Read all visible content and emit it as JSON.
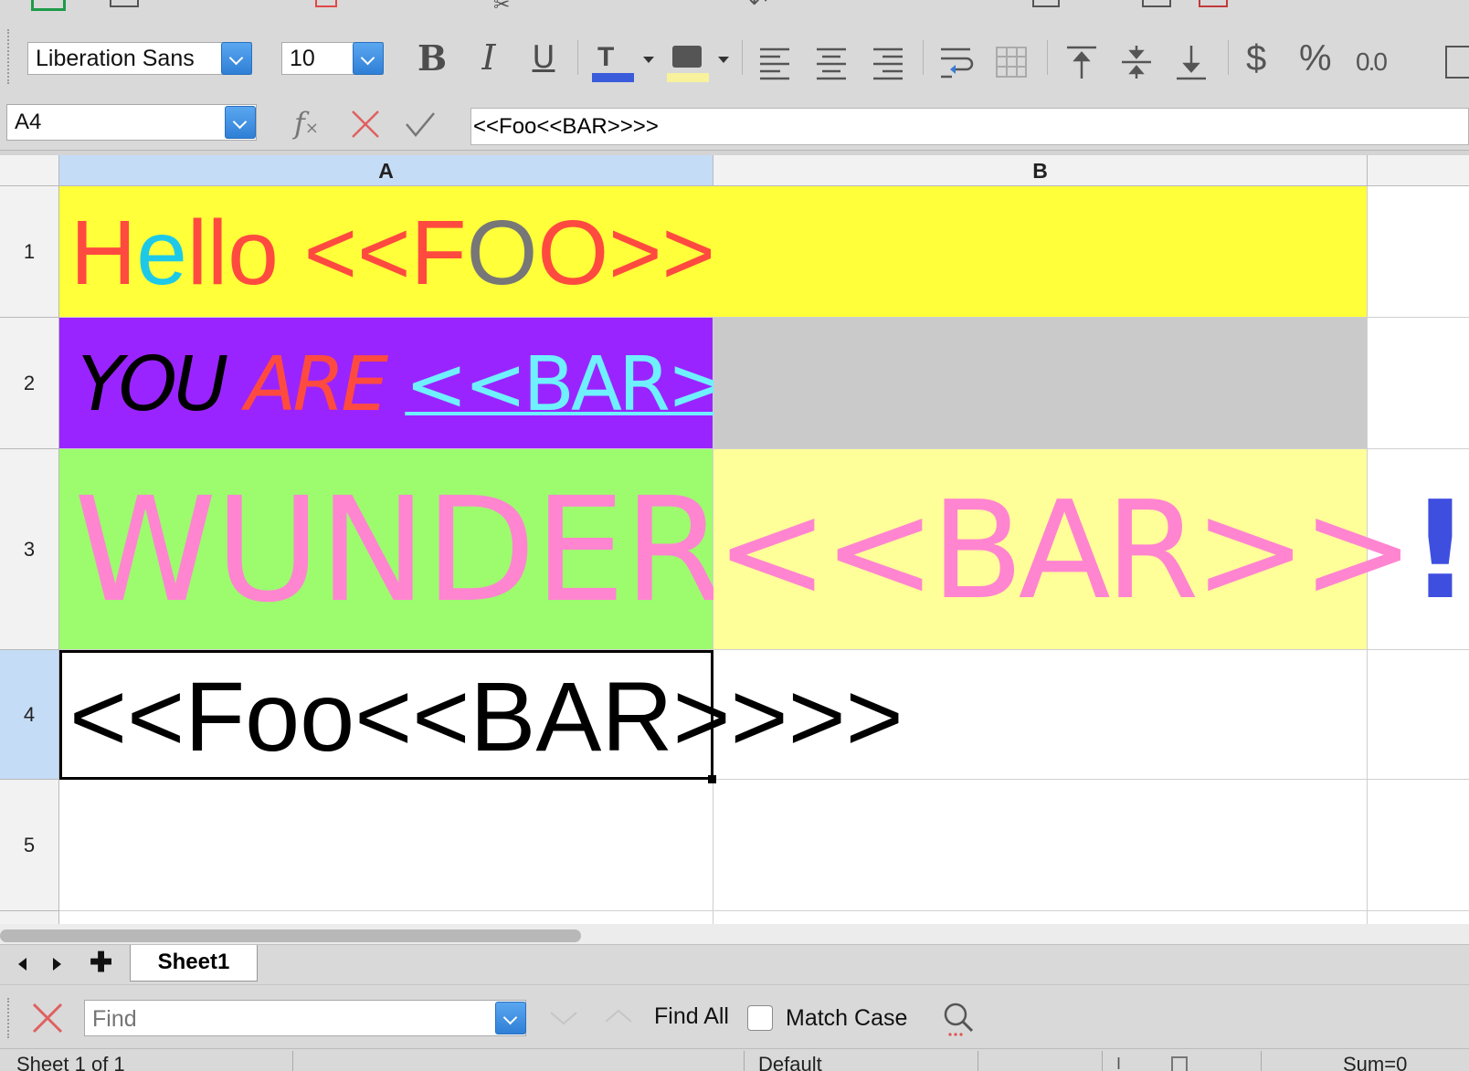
{
  "toolbar": {
    "font_name": "Liberation Sans",
    "font_size": "10",
    "bold_icon": "bold-icon",
    "italic_icon": "italic-icon",
    "underline_icon": "underline-icon",
    "font_color": "#3a5cdb",
    "highlight_color": "#f7f29b",
    "currency_label": "$",
    "percent_label": "%",
    "number_label": "0.0"
  },
  "formula_bar": {
    "name_box": "A4",
    "content": "<<Foo<<BAR>>>>"
  },
  "sheet": {
    "columns": [
      "A",
      "B"
    ],
    "rows": [
      "1",
      "2",
      "3",
      "4",
      "5"
    ],
    "cells": {
      "a1": {
        "parts": [
          "H",
          "e",
          "llo <<F",
          "O",
          "O>>"
        ],
        "bg": "#ffff3a"
      },
      "a2": {
        "you": "YOU",
        "are": "ARE",
        "bar": "<<BAR>>",
        "bg": "#9a24ff"
      },
      "b2": {
        "bg": "#cacaca"
      },
      "a3": {
        "text": "WUNDER",
        "bg": "#9cfc6e"
      },
      "b3": {
        "bar": "<<BAR>>",
        "bang": "!!!",
        "bg": "#ffff99"
      },
      "a4": {
        "text": "<<Foo<<BAR>>>>"
      }
    }
  },
  "tabs": {
    "sheet_tab": "Sheet1"
  },
  "find": {
    "placeholder": "Find",
    "find_all": "Find All",
    "match_case": "Match Case"
  },
  "status": {
    "sheet_info": "Sheet 1 of 1",
    "style": "Default",
    "sum": "Sum=0"
  }
}
